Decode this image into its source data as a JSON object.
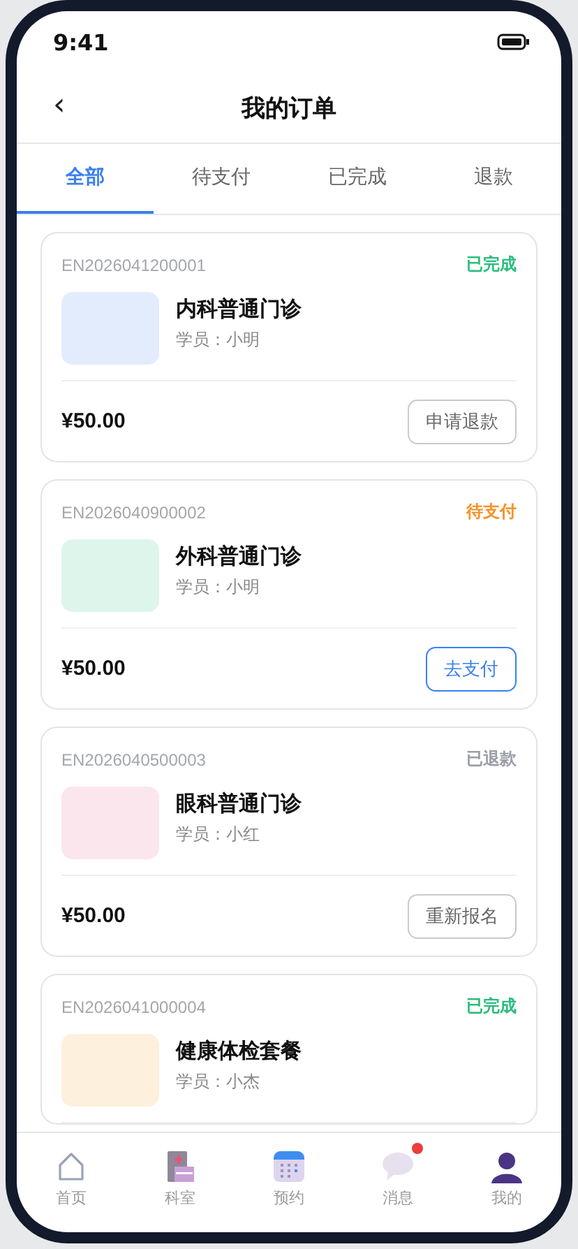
{
  "status_bar": {
    "time": "9:41"
  },
  "header": {
    "back": "‹",
    "title": "我的订单"
  },
  "tabs": [
    {
      "label": "全部",
      "selected": true
    },
    {
      "label": "待支付",
      "selected": false
    },
    {
      "label": "已完成",
      "selected": false
    },
    {
      "label": "退款",
      "selected": false
    }
  ],
  "orders": [
    {
      "number": "EN2026041200001",
      "status": {
        "label": "已完成",
        "color": "#2dbd7e"
      },
      "thumb": {
        "color": "#e3ecfd"
      },
      "title": "内科普通门诊",
      "student": "学员：小明",
      "price": "¥50.00",
      "action": {
        "label": "申请退款",
        "kind": "default"
      }
    },
    {
      "number": "EN2026040900002",
      "status": {
        "label": "待支付",
        "color": "#f5932a"
      },
      "thumb": {
        "color": "#def5ec"
      },
      "title": "外科普通门诊",
      "student": "学员：小明",
      "price": "¥50.00",
      "action": {
        "label": "去支付",
        "kind": "primary"
      }
    },
    {
      "number": "EN2026040500003",
      "status": {
        "label": "已退款",
        "color": "#9a9ea6"
      },
      "thumb": {
        "color": "#fbe6ee"
      },
      "title": "眼科普通门诊",
      "student": "学员：小红",
      "price": "¥50.00",
      "action": {
        "label": "重新报名",
        "kind": "default"
      }
    },
    {
      "number": "EN2026041000004",
      "status": {
        "label": "已完成",
        "color": "#2dbd7e"
      },
      "thumb": {
        "color": "#fdf0dc"
      },
      "title": "健康体检套餐",
      "student": "学员：小杰"
    }
  ],
  "bottom_nav": [
    {
      "kind": "home",
      "label": "首页",
      "badge": false
    },
    {
      "kind": "hospital",
      "label": "科室",
      "badge": false
    },
    {
      "kind": "calendar",
      "label": "预约",
      "badge": false
    },
    {
      "kind": "message",
      "label": "消息",
      "badge": true
    },
    {
      "kind": "person",
      "label": "我的",
      "badge": false
    }
  ]
}
